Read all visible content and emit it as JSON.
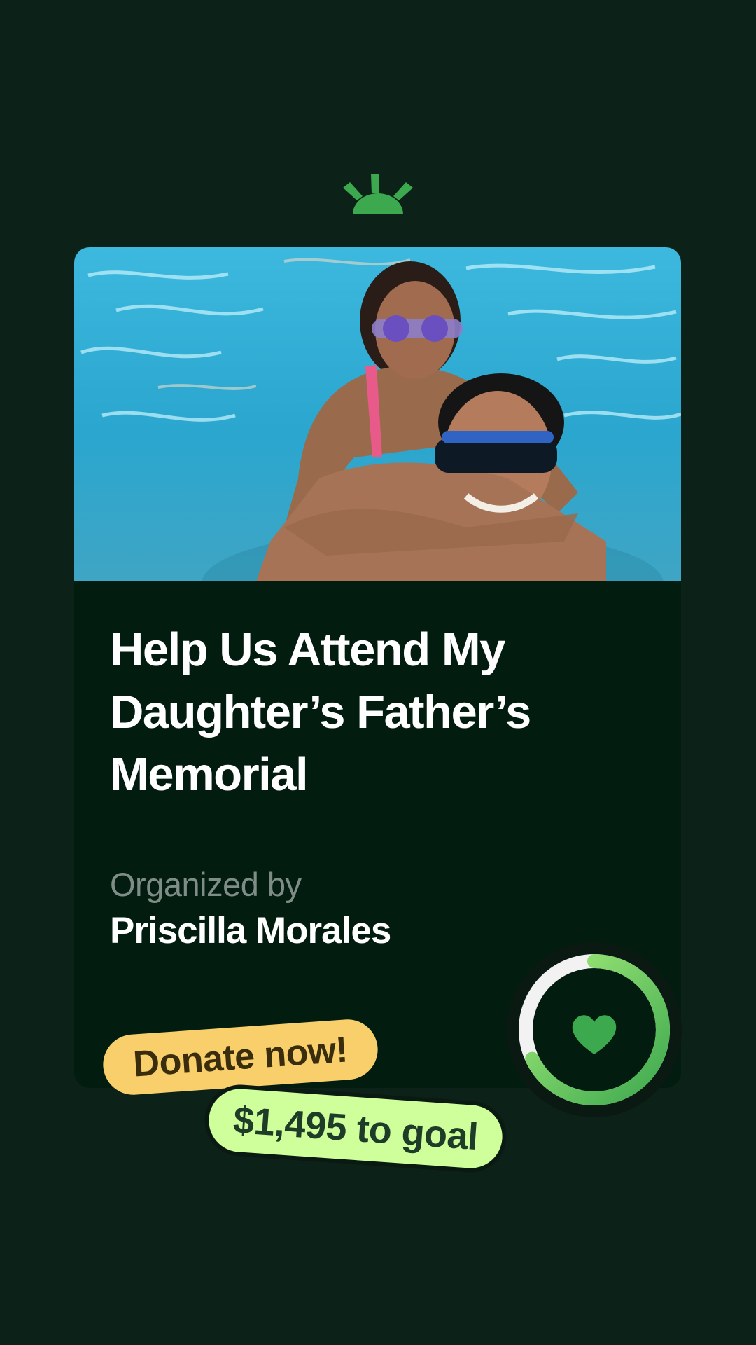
{
  "fundraiser": {
    "title": "Help Us Attend My Daughter’s Father’s Memorial",
    "organized_label": "Organized by",
    "organizer_name": "Priscilla Morales",
    "progress_fraction": 0.68
  },
  "cta": {
    "donate_label": "Donate now!",
    "goal_label": "$1,495 to goal"
  },
  "icons": {
    "logo": "sunrise-logo-icon",
    "heart": "heart-icon"
  },
  "colors": {
    "background": "#0c2219",
    "card": "#021c10",
    "brand_green": "#3da94f",
    "progress_light": "#a6ec7a",
    "donate_pill": "#f8cf6a",
    "goal_pill": "#ceff9b"
  }
}
